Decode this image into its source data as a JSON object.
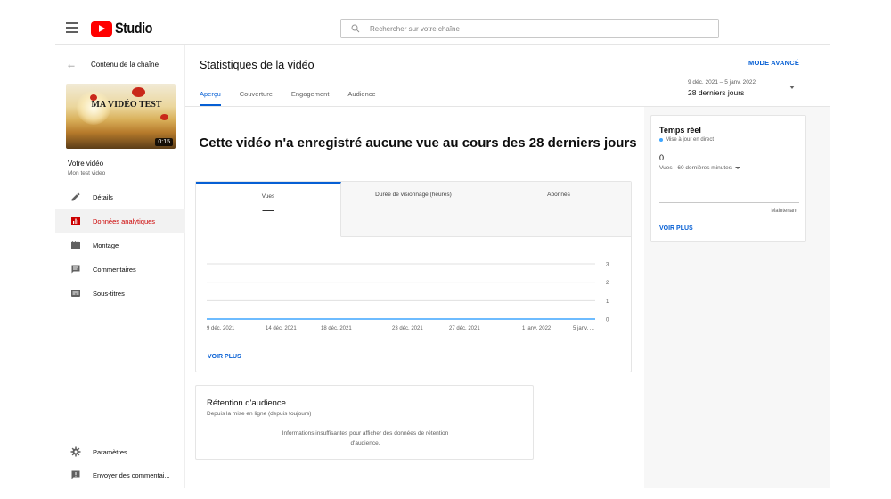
{
  "header": {
    "logo_text": "Studio",
    "search_placeholder": "Rechercher sur votre chaîne"
  },
  "sidebar": {
    "back_label": "Contenu de la chaîne",
    "thumbnail": {
      "title": "MA VIDÉO TEST",
      "duration": "0:15"
    },
    "video_label": "Votre vidéo",
    "video_name": "Mon test video",
    "items": [
      {
        "label": "Détails",
        "icon": "pencil-icon",
        "active": false
      },
      {
        "label": "Données analytiques",
        "icon": "analytics-icon",
        "active": true
      },
      {
        "label": "Montage",
        "icon": "clapper-icon",
        "active": false
      },
      {
        "label": "Commentaires",
        "icon": "comment-icon",
        "active": false
      },
      {
        "label": "Sous-titres",
        "icon": "subtitles-icon",
        "active": false
      }
    ],
    "settings_label": "Paramètres",
    "feedback_label": "Envoyer des commentai..."
  },
  "main": {
    "title": "Statistiques de la vidéo",
    "advanced_mode": "MODE AVANCÉ",
    "tabs": [
      {
        "label": "Aperçu",
        "active": true
      },
      {
        "label": "Couverture",
        "active": false
      },
      {
        "label": "Engagement",
        "active": false
      },
      {
        "label": "Audience",
        "active": false
      }
    ],
    "date_range": "9 déc. 2021 – 5 janv. 2022",
    "period": "28 derniers jours",
    "no_views_message": "Cette vidéo n'a enregistré aucune vue au cours des 28 derniers jours",
    "metrics": [
      {
        "label": "Vues",
        "value": "—"
      },
      {
        "label": "Durée de visionnage (heures)",
        "value": "—"
      },
      {
        "label": "Abonnés",
        "value": "—"
      }
    ],
    "see_more": "VOIR PLUS",
    "retention": {
      "title": "Rétention d'audience",
      "subtitle": "Depuis la mise en ligne (depuis toujours)",
      "message": "Informations insuffisantes pour afficher des données de rétention d'audience."
    }
  },
  "realtime": {
    "title": "Temps réel",
    "live_label": "Mise à jour en direct",
    "count": "0",
    "views_label": "Vues · 60 dernières minutes",
    "now_label": "Maintenant",
    "see_more": "VOIR PLUS"
  },
  "chart_data": {
    "type": "line",
    "x": [
      "9 déc. 2021",
      "14 déc. 2021",
      "18 déc. 2021",
      "23 déc. 2021",
      "27 déc. 2021",
      "1 janv. 2022",
      "5 janv. ..."
    ],
    "series": [
      {
        "values": [
          0,
          0,
          0,
          0,
          0,
          0,
          0
        ]
      }
    ],
    "y_ticks": [
      "3",
      "2",
      "1",
      "0"
    ],
    "ylim": [
      0,
      3
    ],
    "grid": true,
    "line_color": "#3ea6ff"
  }
}
